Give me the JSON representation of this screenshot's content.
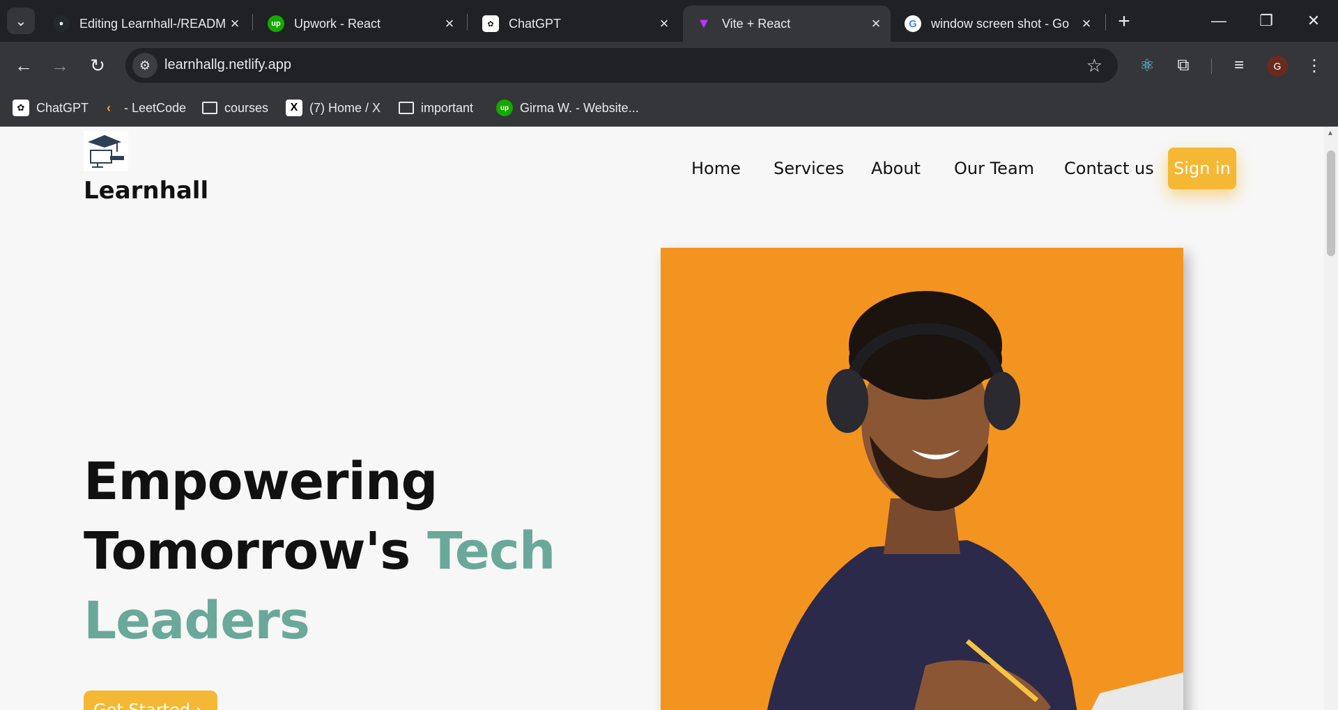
{
  "browser": {
    "tabs": [
      {
        "label": "Editing Learnhall-/READM",
        "favicon": "github-icon",
        "active": false
      },
      {
        "label": "Upwork - React",
        "favicon": "upwork-icon",
        "active": false
      },
      {
        "label": "ChatGPT",
        "favicon": "chatgpt-icon",
        "active": false
      },
      {
        "label": "Vite + React",
        "favicon": "vite-icon",
        "active": true
      },
      {
        "label": "window screen shot - Go",
        "favicon": "google-icon",
        "active": false
      }
    ],
    "url": "learnhallg.netlify.app",
    "profile_initial": "G",
    "bookmarks": [
      {
        "label": "ChatGPT",
        "icon": "chatgpt-icon"
      },
      {
        "label": "- LeetCode",
        "icon": "leetcode-icon"
      },
      {
        "label": "courses",
        "icon": "folder-icon"
      },
      {
        "label": "(7) Home / X",
        "icon": "x-icon"
      },
      {
        "label": "important",
        "icon": "folder-icon"
      },
      {
        "label": "Girma W. - Website...",
        "icon": "upwork-icon"
      }
    ]
  },
  "site": {
    "brand": "Learnhall",
    "nav": {
      "home": "Home",
      "services": "Services",
      "about": "About",
      "team": "Our Team",
      "contact": "Contact us",
      "signin": "Sign in"
    },
    "hero": {
      "line1": "Empowering",
      "line2": "Tomorrow's",
      "line2_accent": "Tech",
      "line3_accent": "Leaders",
      "cta": "Get Started"
    }
  },
  "colors": {
    "accent_teal": "#6aa89a",
    "accent_yellow": "#f5b835",
    "photo_bg": "#f49420"
  }
}
